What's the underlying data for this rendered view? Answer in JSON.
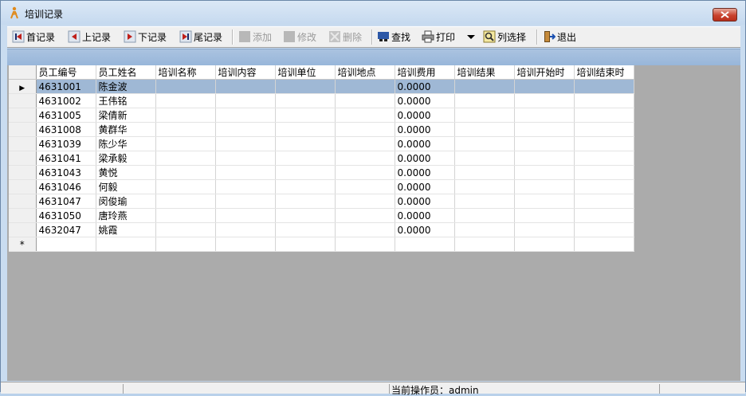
{
  "window": {
    "title": "培训记录"
  },
  "toolbar": {
    "first": "首记录",
    "prev": "上记录",
    "next": "下记录",
    "last": "尾记录",
    "add": "添加",
    "edit": "修改",
    "delete": "删除",
    "find": "查找",
    "print": "打印",
    "columns": "列选择",
    "exit": "退出"
  },
  "grid": {
    "columns": [
      "员工编号",
      "员工姓名",
      "培训名称",
      "培训内容",
      "培训单位",
      "培训地点",
      "培训费用",
      "培训结果",
      "培训开始时",
      "培训结束时"
    ],
    "rows": [
      {
        "id": "4631001",
        "name": "陈金波",
        "fee": "0.0000"
      },
      {
        "id": "4631002",
        "name": "王伟铭",
        "fee": "0.0000"
      },
      {
        "id": "4631005",
        "name": "梁倩新",
        "fee": "0.0000"
      },
      {
        "id": "4631008",
        "name": "黄群华",
        "fee": "0.0000"
      },
      {
        "id": "4631039",
        "name": "陈少华",
        "fee": "0.0000"
      },
      {
        "id": "4631041",
        "name": "梁承毅",
        "fee": "0.0000"
      },
      {
        "id": "4631043",
        "name": "黄悦",
        "fee": "0.0000"
      },
      {
        "id": "4631046",
        "name": "何毅",
        "fee": "0.0000"
      },
      {
        "id": "4631047",
        "name": "闵俊瑜",
        "fee": "0.0000"
      },
      {
        "id": "4631050",
        "name": "唐玲燕",
        "fee": "0.0000"
      },
      {
        "id": "4632047",
        "name": "姚霞",
        "fee": "0.0000"
      }
    ],
    "current_marker": "▶",
    "new_row_marker": "*"
  },
  "status": {
    "operator": "当前操作员：admin"
  },
  "colors": {
    "selected_row": "#9fb8d5",
    "grid_bg": "#ababab",
    "band": "#98b6da"
  }
}
